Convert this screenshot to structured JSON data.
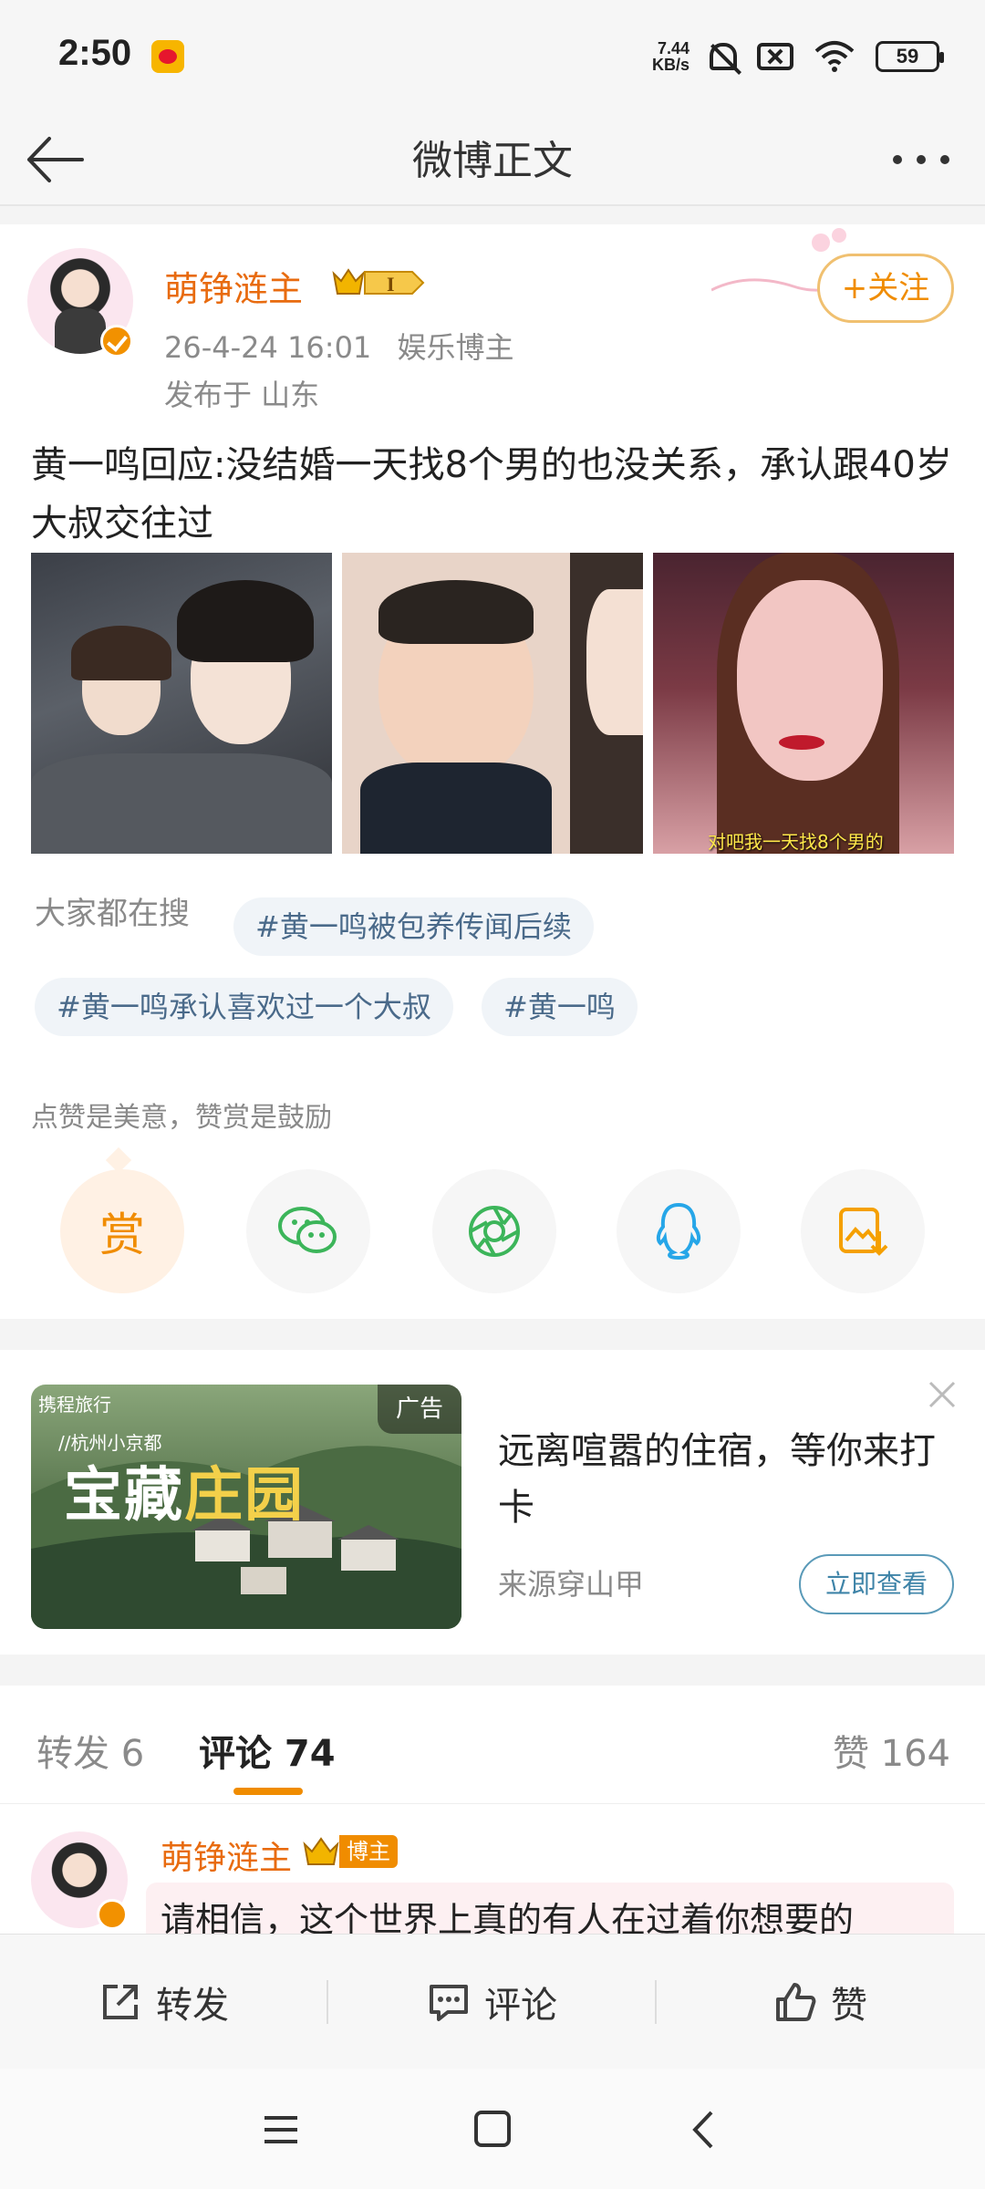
{
  "status_bar": {
    "time": "2:50",
    "net_speed_value": "7.44",
    "net_speed_unit": "KB/s",
    "battery": "59",
    "icons": [
      "weibo-app-icon",
      "mute-bell-icon",
      "no-sim-icon",
      "wifi-icon",
      "battery-icon"
    ]
  },
  "header": {
    "title": "微博正文",
    "back_icon": "arrow-left-icon",
    "more_icon": "more-dots-icon"
  },
  "post": {
    "author": "萌铮涟主",
    "vip_level": "I",
    "date": "26-4-24 16:01",
    "tag": "娱乐博主",
    "location": "发布于 山东",
    "follow_label": "+关注",
    "text": "黄一鸣回应:没结婚一天找8个男的也没关系，承认跟40岁大叔交往过",
    "images": [
      {
        "caption": ""
      },
      {
        "caption": ""
      },
      {
        "caption": "对吧我一天找8个男的"
      }
    ],
    "search_label": "大家都在搜",
    "tags": [
      "#黄一鸣被包养传闻后续",
      "#黄一鸣承认喜欢过一个大叔",
      "#黄一鸣"
    ],
    "reward_prompt": "点赞是美意，赞赏是鼓励",
    "reward_label": "赏",
    "share_icons": [
      "reward-icon",
      "wechat-icon",
      "moments-icon",
      "qq-icon",
      "save-image-icon"
    ]
  },
  "ad": {
    "badge": "广告",
    "brand": "携程旅行",
    "subtitle": "//杭州小京都",
    "art_title_1": "宝藏",
    "art_title_2": "庄园",
    "headline": "远离喧嚣的住宿，等你来打卡",
    "source": "来源穿山甲",
    "cta": "立即查看"
  },
  "tabs": {
    "repost": "转发 6",
    "comments": "评论 74",
    "likes": "赞 164"
  },
  "comment": {
    "author": "萌铮涟主",
    "badge": "博主",
    "text": "请相信，这个世界上真的有人在过着你想要的"
  },
  "actions": {
    "repost": "转发",
    "comment": "评论",
    "like": "赞"
  },
  "colors": {
    "accent": "#f08c00",
    "author_name": "#e86b0f",
    "link": "#4a6a8a"
  }
}
